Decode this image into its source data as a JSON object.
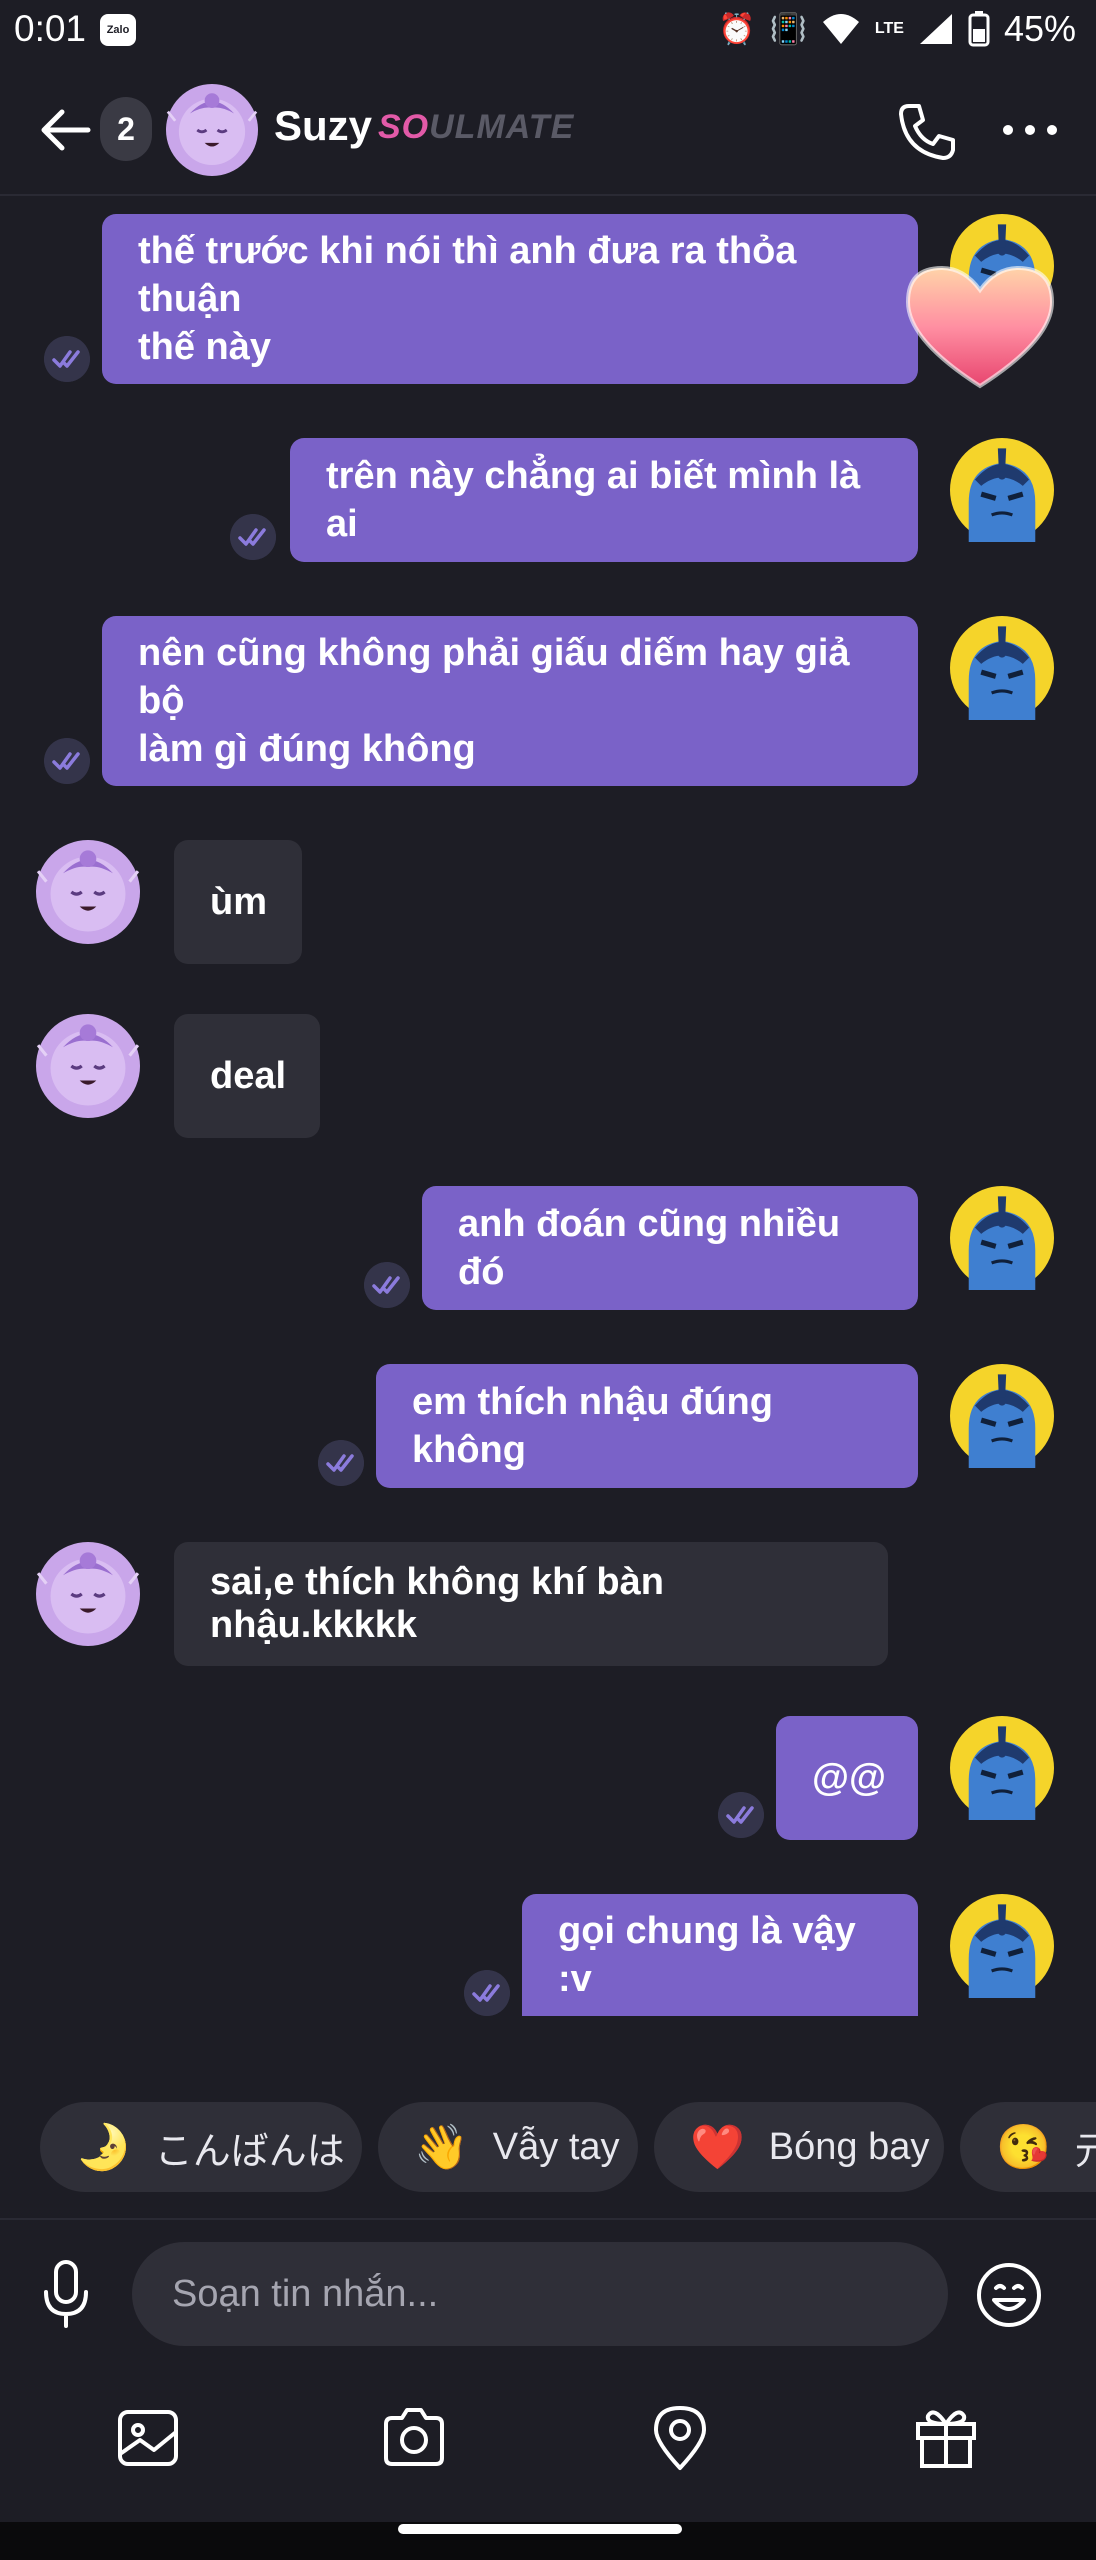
{
  "status_bar": {
    "time": "0:01",
    "notification_app": "Zalo",
    "battery": "45%",
    "network": "LTE",
    "icons": [
      "alarm-icon",
      "vibrate-icon",
      "wifi-icon",
      "signal-icon",
      "battery-icon"
    ]
  },
  "header": {
    "back_icon": "arrow-left-icon",
    "unread_count": "2",
    "contact_name": "Suzy",
    "badge_prefix": "SO",
    "badge_suffix": "ULMATE",
    "call_icon": "phone-icon",
    "more_icon": "more-horizontal-icon"
  },
  "messages": [
    {
      "direction": "out",
      "lines": [
        "thế trước khi nói thì anh đưa ra thỏa thuận",
        "thế này"
      ],
      "read": true,
      "reaction": "heart"
    },
    {
      "direction": "out",
      "lines": [
        "trên này chẳng ai biết mình là ai"
      ],
      "read": true
    },
    {
      "direction": "out",
      "lines": [
        "nên cũng không phải giấu diếm hay giả bộ",
        "làm gì đúng không"
      ],
      "read": true
    },
    {
      "direction": "in",
      "lines": [
        "ùm"
      ]
    },
    {
      "direction": "in",
      "lines": [
        "deal"
      ]
    },
    {
      "direction": "out",
      "lines": [
        "anh đoán cũng nhiều đó"
      ],
      "read": true
    },
    {
      "direction": "out",
      "lines": [
        "em thích nhậu đúng không"
      ],
      "read": true
    },
    {
      "direction": "in",
      "lines": [
        "sai,e thích không khí bàn nhậu.kkkkk"
      ]
    },
    {
      "direction": "out",
      "lines": [
        "@@"
      ],
      "read": true
    },
    {
      "direction": "out",
      "lines": [
        "gọi chung là vậy :v"
      ],
      "read": true
    }
  ],
  "suggestions": [
    {
      "emoji": "🌛",
      "label": "こんばんは"
    },
    {
      "emoji": "👋",
      "label": "Vẫy tay"
    },
    {
      "emoji": "❤️",
      "label": "Bóng bay"
    },
    {
      "emoji": "😘",
      "label": "元"
    }
  ],
  "composer": {
    "placeholder": "Soạn tin nhắn...",
    "mic_icon": "microphone-icon",
    "emoji_icon": "smiley-icon"
  },
  "toolbar": [
    "image-icon",
    "camera-icon",
    "location-pin-icon",
    "gift-icon"
  ],
  "colors": {
    "background": "#1d1d25",
    "outgoing_bubble": "#7a62c8",
    "incoming_bubble": "#2f2f38",
    "brand_pink": "#e25aa8",
    "read_check": "#8b7bdc"
  }
}
